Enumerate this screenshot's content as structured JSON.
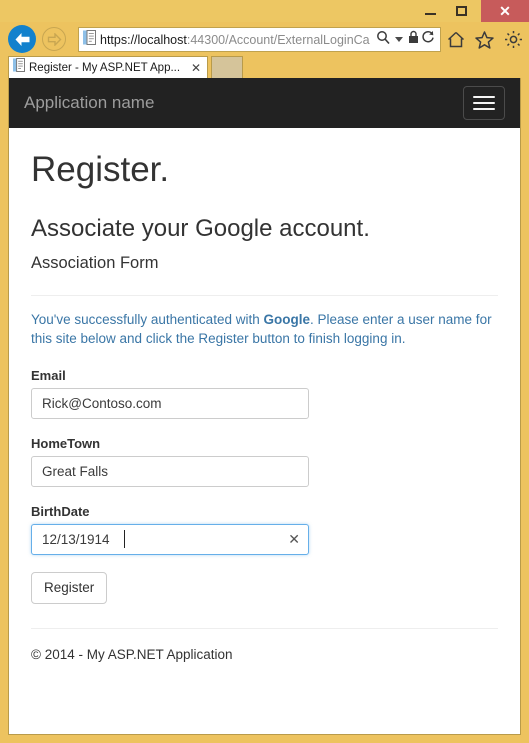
{
  "browser": {
    "window_controls": {
      "minimize": "—",
      "maximize": "□",
      "close": "✕"
    },
    "nav": {
      "back_icon": "back-arrow-icon",
      "forward_icon": "forward-arrow-icon",
      "url_scheme_host": "https://localhost",
      "url_rest": ":44300/Account/ExternalLoginCa",
      "search_icon": "search-icon",
      "lock_icon": "lock-icon",
      "refresh_icon": "refresh-icon",
      "home_icon": "home-icon",
      "favorites_icon": "star-icon",
      "tools_icon": "gear-icon"
    },
    "tab": {
      "title": "Register - My ASP.NET App...",
      "close_label": "✕"
    }
  },
  "site": {
    "navbar": {
      "brand": "Application name",
      "toggle_label": "Toggle navigation"
    },
    "heading": "Register.",
    "subheading": "Associate your Google account.",
    "form_heading": "Association Form",
    "info": {
      "part1": "You've successfully authenticated with ",
      "provider": "Google",
      "part2": ". Please enter a user name for this site below and click the Register button to finish logging in."
    },
    "fields": [
      {
        "label": "Email",
        "value": "Rick@Contoso.com",
        "placeholder": "",
        "focused": false,
        "has_clear": false
      },
      {
        "label": "HomeTown",
        "value": "Great Falls",
        "placeholder": "",
        "focused": false,
        "has_clear": false
      },
      {
        "label": "BirthDate",
        "value": "12/13/1914",
        "placeholder": "",
        "focused": true,
        "has_clear": true,
        "clear_label": "✕"
      }
    ],
    "submit_label": "Register",
    "footer": "© 2014 - My ASP.NET Application"
  },
  "colors": {
    "window_frame": "#edc35f",
    "close_button": "#c75b5b",
    "navbar_bg": "#222222",
    "brand_text": "#9d9d9d",
    "info_text": "#3a76a6",
    "focus_border": "#66afe9",
    "back_button": "#1281cd"
  }
}
